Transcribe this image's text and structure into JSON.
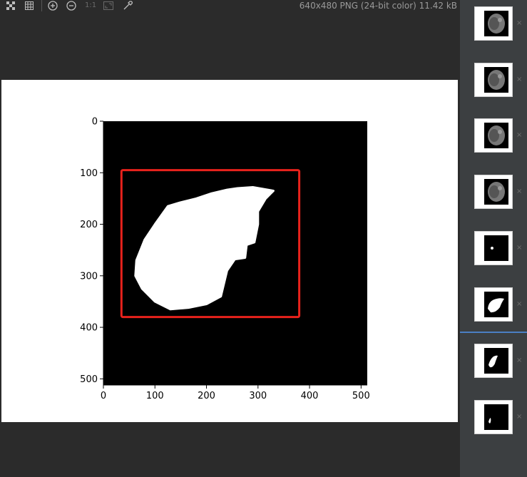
{
  "toolbar": {
    "icons": [
      "checkerboard-icon",
      "grid-icon",
      "zoom-in-icon",
      "zoom-out-icon",
      "actual-size-icon",
      "fit-window-icon",
      "color-picker-icon"
    ],
    "actual_size_label": "1:1",
    "file_info": "640x480 PNG (24-bit color) 11.42 kB"
  },
  "colors": {
    "background": "#2b2b2b",
    "strip": "#3c3f41",
    "selection": "#4b7fc3",
    "bbox": "#e8221c"
  },
  "chart_data": {
    "type": "image",
    "xticks": [
      "0",
      "100",
      "200",
      "300",
      "400",
      "500"
    ],
    "yticks": [
      "0",
      "100",
      "200",
      "300",
      "400",
      "500"
    ],
    "xlim": [
      0,
      512
    ],
    "ylim": [
      512,
      0
    ],
    "bounding_box": {
      "x0": 35,
      "y0": 95,
      "x1": 380,
      "y1": 380
    },
    "mask_outline": [
      [
        130,
        365
      ],
      [
        100,
        350
      ],
      [
        75,
        325
      ],
      [
        62,
        300
      ],
      [
        64,
        270
      ],
      [
        80,
        230
      ],
      [
        100,
        200
      ],
      [
        125,
        165
      ],
      [
        148,
        158
      ],
      [
        180,
        150
      ],
      [
        210,
        140
      ],
      [
        240,
        133
      ],
      [
        260,
        130
      ],
      [
        290,
        128
      ],
      [
        330,
        135
      ],
      [
        315,
        150
      ],
      [
        300,
        175
      ],
      [
        300,
        200
      ],
      [
        293,
        235
      ],
      [
        278,
        240
      ],
      [
        275,
        265
      ],
      [
        255,
        268
      ],
      [
        240,
        290
      ],
      [
        228,
        340
      ],
      [
        200,
        355
      ],
      [
        165,
        362
      ]
    ]
  },
  "thumbnails": [
    {
      "kind": "ct-slice",
      "close": "×"
    },
    {
      "kind": "ct-slice",
      "close": "×"
    },
    {
      "kind": "ct-slice",
      "close": "×"
    },
    {
      "kind": "ct-slice",
      "close": "×"
    },
    {
      "kind": "mask-dot",
      "close": "×"
    },
    {
      "kind": "mask-liver",
      "close": "×"
    },
    {
      "kind": "mask-liver-small",
      "close": "×"
    },
    {
      "kind": "mask-tiny",
      "close": "×"
    }
  ]
}
